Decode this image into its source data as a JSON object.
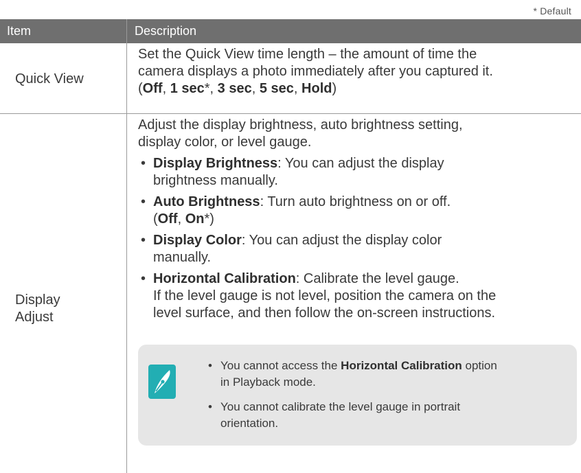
{
  "default_note": "* Default",
  "header": {
    "item": "Item",
    "description": "Description"
  },
  "rows": [
    {
      "item": "Quick View",
      "description_lines": [
        "Set the Quick View time length – the amount of time the",
        "camera displays a photo immediately after you captured it."
      ],
      "options": {
        "open": "(",
        "o1": "Off",
        "s1": ", ",
        "o2": "1 sec",
        "s2": "*, ",
        "o3": "3 sec",
        "s3": ", ",
        "o4": "5 sec",
        "s4": ", ",
        "o5": "Hold",
        "close": ")"
      }
    },
    {
      "item_line1": "Display",
      "item_line2": "Adjust",
      "intro_line1": "Adjust the display brightness, auto brightness setting,",
      "intro_line2": "display color, or level gauge.",
      "bullets": [
        {
          "term": "Display Brightness",
          "text1": ": You can adjust the display",
          "text2": "brightness manually."
        },
        {
          "term": "Auto Brightness",
          "text1": ": Turn auto brightness on or off.",
          "opt_open": "(",
          "opt1": "Off",
          "opt_sep": ", ",
          "opt2": "On",
          "opt_close": "*)"
        },
        {
          "term": "Display Color",
          "text1": ": You can adjust the display color",
          "text2": "manually."
        },
        {
          "term": "Horizontal Calibration",
          "text1": ": Calibrate the level gauge.",
          "text2": "If the level gauge is not level, position the camera on the",
          "text3": "level surface, and then follow the on-screen instructions."
        }
      ]
    }
  ],
  "note": {
    "icon": "pen-note-icon",
    "items": [
      {
        "pre": "You cannot access the ",
        "term": "Horizontal Calibration",
        "post1": " option",
        "post2": "in Playback mode."
      },
      {
        "line1": "You cannot calibrate the level gauge in portrait",
        "line2": "orientation."
      }
    ]
  },
  "colors": {
    "header_bg": "#6f6f6f",
    "note_bg": "#e6e6e6",
    "icon_accent": "#22aeb3"
  }
}
